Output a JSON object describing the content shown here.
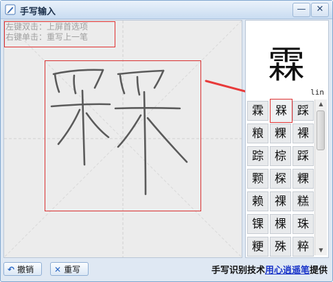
{
  "window": {
    "title": "手写输入",
    "minimize_label": "—",
    "close_label": "✕"
  },
  "hint": {
    "line1": "左键双击：上屏首选项",
    "line2": "右键单击：重写上一笔"
  },
  "preview": {
    "char": "霖",
    "pinyin": "lin"
  },
  "candidates": [
    [
      "霖",
      "槑",
      "踩"
    ],
    [
      "粮",
      "粿",
      "裸"
    ],
    [
      "踪",
      "棕",
      "踩"
    ],
    [
      "颗",
      "棎",
      "粿"
    ],
    [
      "赖",
      "祼",
      "糕"
    ],
    [
      "锞",
      "棵",
      "珠"
    ],
    [
      "粳",
      "殊",
      "粹"
    ]
  ],
  "selected_candidate": "槑",
  "footer": {
    "undo_label": "撤销",
    "rewrite_label": "重写",
    "credit_prefix": "手写识别技术",
    "credit_link": "用心逍遥笔",
    "credit_suffix": "提供"
  },
  "colors": {
    "annotation_red": "#e03030",
    "arrow_red": "#e83a3a",
    "stroke": "#5a5a5a"
  },
  "icons": [
    "pen-icon",
    "undo-icon",
    "close-x-icon"
  ]
}
